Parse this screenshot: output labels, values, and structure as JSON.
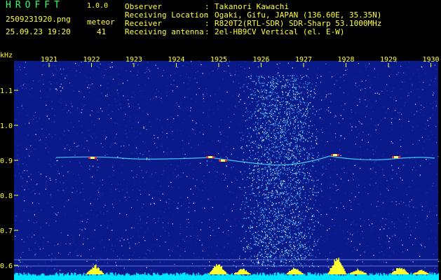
{
  "app": {
    "name": "HROFFT",
    "version": "1.0.0"
  },
  "file": {
    "name": "2509231920.png",
    "datetime": "25.09.23 19:20"
  },
  "detection": {
    "mode": "meteor",
    "count": "41"
  },
  "info": [
    {
      "label": "Observer",
      "sep": ":",
      "value": "Takanori Kawachi"
    },
    {
      "label": "Receiving Location",
      "sep": ":",
      "value": "Ogaki, Gifu, JAPAN (136.60E, 35.35N)"
    },
    {
      "label": "Receiver",
      "sep": ":",
      "value": "R820T2(RTL-SDR) SDR-Sharp 53.1000MHz"
    },
    {
      "label": "Receiving antenna",
      "sep": ":",
      "value": "2el-HB9CV Vertical (el. E-W)"
    }
  ],
  "axes": {
    "y_unit": "kHz",
    "y_ticks": [
      "1.1",
      "1.0",
      "0.9",
      "0.8",
      "0.7",
      "0.6"
    ],
    "x_ticks": [
      "1921",
      "1922",
      "1923",
      "1924",
      "1925",
      "1926",
      "1927",
      "1928",
      "1929",
      "1930"
    ]
  },
  "colors": {
    "background": "#0b1a8a",
    "axis_text": "#ffff33",
    "title_green": "#33ff66",
    "spectrum_cyan": "#00e5ff",
    "spectrum_yellow": "#ffff33"
  }
}
